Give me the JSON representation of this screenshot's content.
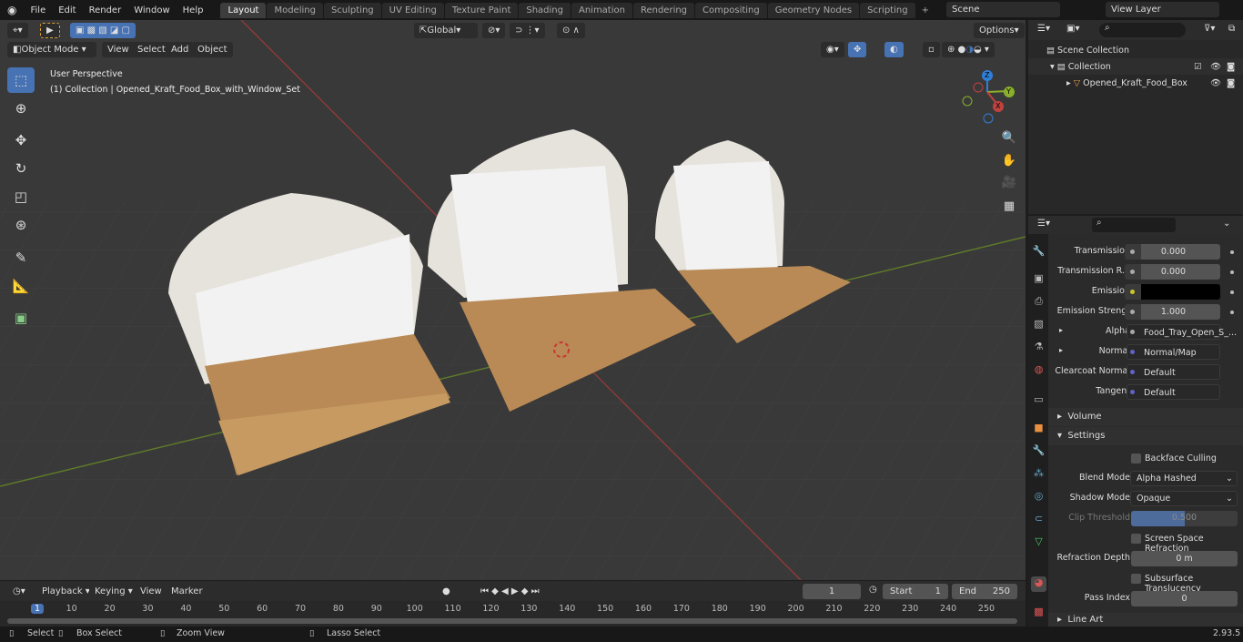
{
  "topbar": {
    "menus": [
      "File",
      "Edit",
      "Render",
      "Window",
      "Help"
    ],
    "workspaces": [
      "Layout",
      "Modeling",
      "Sculpting",
      "UV Editing",
      "Texture Paint",
      "Shading",
      "Animation",
      "Rendering",
      "Compositing",
      "Geometry Nodes",
      "Scripting"
    ],
    "active_workspace": "Layout",
    "scene": "Scene",
    "view_layer": "View Layer"
  },
  "viewport": {
    "mode": "Object Mode",
    "menus": [
      "View",
      "Select",
      "Add",
      "Object"
    ],
    "transform_orientation": "Global",
    "options_label": "Options",
    "overlay_title": "User Perspective",
    "overlay_subtitle": "(1) Collection | Opened_Kraft_Food_Box_with_Window_Set",
    "gizmo": {
      "z": "Z",
      "y": "Y",
      "x": "X"
    }
  },
  "outliner": {
    "scene_collection": "Scene Collection",
    "collection": "Collection",
    "object": "Opened_Kraft_Food_Box",
    "search_placeholder": ""
  },
  "properties": {
    "rows": [
      {
        "label": "Transmission",
        "value": "0.000"
      },
      {
        "label": "Transmission R...",
        "value": "0.000"
      },
      {
        "label": "Emission",
        "value": ""
      },
      {
        "label": "Emission Strengt",
        "value": "1.000"
      },
      {
        "label": "Alpha",
        "value": "Food_Tray_Open_S_..."
      },
      {
        "label": "Normal",
        "value": "Normal/Map"
      },
      {
        "label": "Clearcoat Normal",
        "value": "Default"
      },
      {
        "label": "Tangent",
        "value": "Default"
      }
    ],
    "volume": "Volume",
    "settings": "Settings",
    "backface_culling": "Backface Culling",
    "blend_mode_label": "Blend Mode",
    "blend_mode": "Alpha Hashed",
    "shadow_mode_label": "Shadow Mode",
    "shadow_mode": "Opaque",
    "clip_threshold_label": "Clip Threshold",
    "clip_threshold": "0.500",
    "ssr": "Screen Space Refraction",
    "refraction_depth_label": "Refraction Depth",
    "refraction_depth": "0 m",
    "sss": "Subsurface Translucency",
    "pass_index_label": "Pass Index",
    "pass_index": "0",
    "line_art": "Line Art",
    "emission_color": "#000000"
  },
  "timeline": {
    "menus": [
      "Playback",
      "Keying",
      "View",
      "Marker"
    ],
    "current_frame": "1",
    "start_label": "Start",
    "start": "1",
    "end_label": "End",
    "end": "250",
    "ticks": [
      "1",
      "10",
      "20",
      "30",
      "40",
      "50",
      "60",
      "70",
      "80",
      "90",
      "100",
      "110",
      "120",
      "130",
      "140",
      "150",
      "160",
      "170",
      "180",
      "190",
      "200",
      "210",
      "220",
      "230",
      "240",
      "250"
    ]
  },
  "status": {
    "select": "Select",
    "box_select": "Box Select",
    "zoom_view": "Zoom View",
    "lasso_select": "Lasso Select",
    "version": "2.93.5"
  },
  "colors": {
    "accent": "#4772b3",
    "x_axis": "#c0423f",
    "y_axis": "#8ab02a",
    "z_axis": "#2f7fd6"
  }
}
